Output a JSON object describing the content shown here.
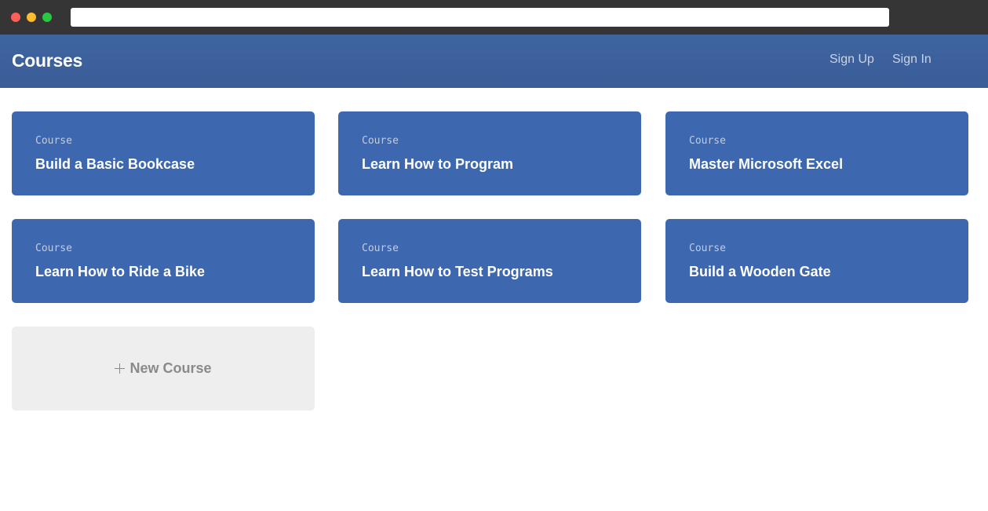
{
  "header": {
    "title": "Courses",
    "nav": [
      {
        "label": "Sign Up"
      },
      {
        "label": "Sign In"
      }
    ]
  },
  "courses": [
    {
      "kind": "Course",
      "title": "Build a Basic Bookcase"
    },
    {
      "kind": "Course",
      "title": "Learn How to Program"
    },
    {
      "kind": "Course",
      "title": "Master Microsoft Excel"
    },
    {
      "kind": "Course",
      "title": "Learn How to Ride a Bike"
    },
    {
      "kind": "Course",
      "title": "Learn How to Test Programs"
    },
    {
      "kind": "Course",
      "title": "Build a Wooden Gate"
    }
  ],
  "new_course": {
    "label": "New Course",
    "icon": "plus-icon"
  },
  "colors": {
    "header": "#3a5d98",
    "card": "#3d67ae",
    "new_course_bg": "#eeeeee"
  }
}
